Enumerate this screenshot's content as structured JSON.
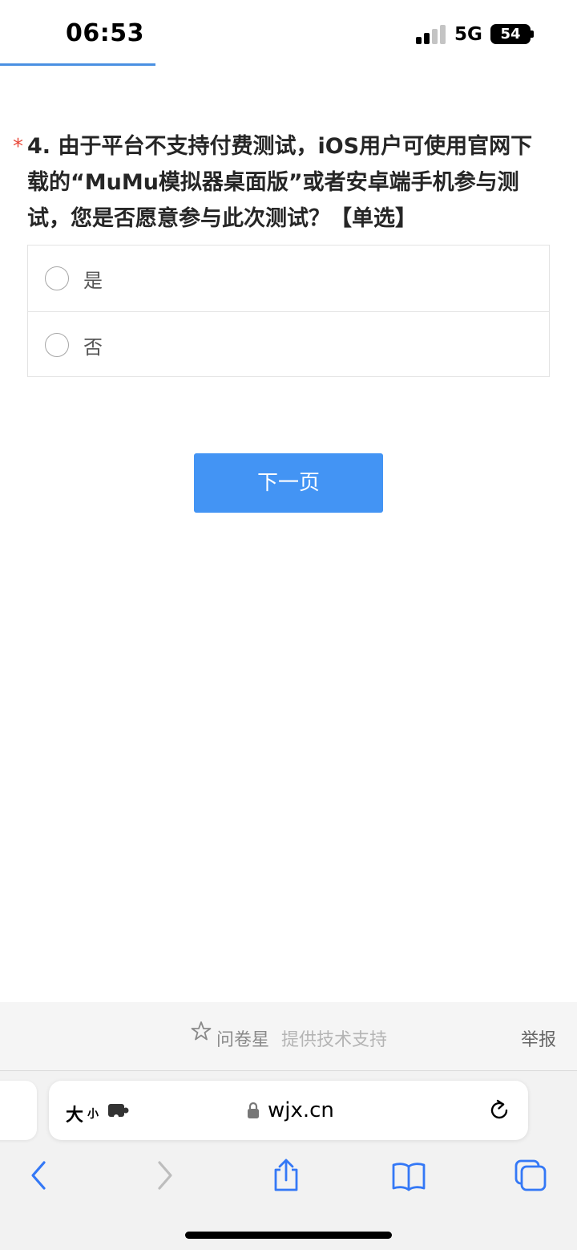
{
  "status_bar": {
    "time": "06:53",
    "network": "5G",
    "battery": "54"
  },
  "survey": {
    "progress": 0.27,
    "question": {
      "required_mark": "*",
      "title": "4. 由于平台不支持付费测试，iOS用户可使用官网下载的“MuMu模拟器桌面版”或者安卓端手机参与测试，您是否愿意参与此次测试？【单选】",
      "options": [
        {
          "label": "是"
        },
        {
          "label": "否"
        }
      ]
    },
    "next_button": "下一页"
  },
  "footer": {
    "brand": "问卷星",
    "tagline": "提供技术支持",
    "report": "举报"
  },
  "browser": {
    "text_size_big": "大",
    "text_size_small": "小",
    "url": "wjx.cn",
    "accent_color": "#3478f6"
  }
}
